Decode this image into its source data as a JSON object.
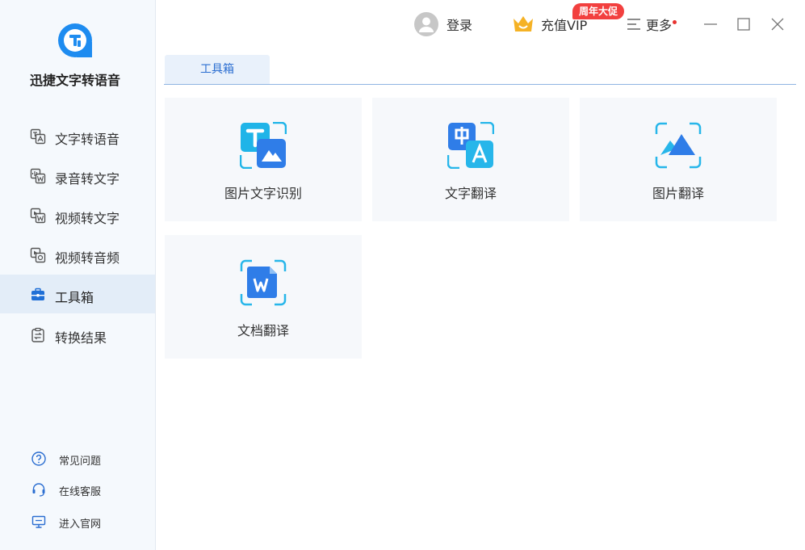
{
  "app": {
    "name": "迅捷文字转语音"
  },
  "sidebar": {
    "items": [
      {
        "label": "文字转语音",
        "icon": "text-to-speech-icon"
      },
      {
        "label": "录音转文字",
        "icon": "audio-to-text-icon"
      },
      {
        "label": "视频转文字",
        "icon": "video-to-text-icon"
      },
      {
        "label": "视频转音频",
        "icon": "video-to-audio-icon"
      },
      {
        "label": "工具箱",
        "icon": "toolbox-icon",
        "active": true
      },
      {
        "label": "转换结果",
        "icon": "results-icon"
      }
    ],
    "help": [
      {
        "label": "常见问题",
        "icon": "question-icon"
      },
      {
        "label": "在线客服",
        "icon": "headset-icon"
      },
      {
        "label": "进入官网",
        "icon": "monitor-icon"
      }
    ]
  },
  "header": {
    "login_label": "登录",
    "vip_label": "充值VIP",
    "promo_badge": "周年大促",
    "more_label": "更多"
  },
  "tabs": [
    {
      "label": "工具箱",
      "active": true
    }
  ],
  "tools": [
    {
      "label": "图片文字识别",
      "icon": "image-ocr-icon"
    },
    {
      "label": "文字翻译",
      "icon": "text-translate-icon"
    },
    {
      "label": "图片翻译",
      "icon": "image-translate-icon"
    },
    {
      "label": "文档翻译",
      "icon": "document-translate-icon"
    }
  ],
  "colors": {
    "accent": "#2b6ed1",
    "sidebar_bg": "#f5f9fd",
    "active_bg": "#e3edf8",
    "promo": "#f2403f",
    "card_bg": "#f6f8fb"
  }
}
